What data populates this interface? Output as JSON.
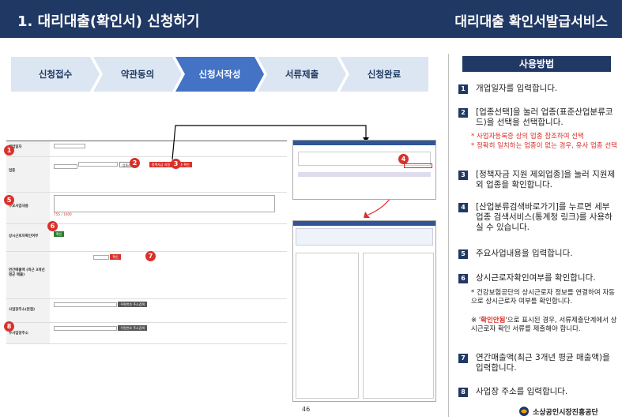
{
  "header": {
    "title": "1. 대리대출(확인서) 신청하기",
    "service": "대리대출 확인서발급서비스"
  },
  "steps": [
    {
      "label": "신청접수",
      "active": false
    },
    {
      "label": "약관동의",
      "active": false
    },
    {
      "label": "신청서작성",
      "active": true
    },
    {
      "label": "서류제출",
      "active": false
    },
    {
      "label": "신청완료",
      "active": false
    }
  ],
  "usage": {
    "title": "사용방법",
    "items": [
      {
        "num": "1",
        "text": "개업일자를 입력합니다."
      },
      {
        "num": "2",
        "text": "[업종선택]을 눌러 업종(표준산업분류코드)을 선택을 선택합니다."
      },
      {
        "num": "3",
        "text": "[정책자금 지원 제외업종]을 눌러 지원제외 업종을 확인합니다."
      },
      {
        "num": "4",
        "text": "[산업분류검색바로가기]를 누르면 세부업종 검색서비스(통계청 링크)를 사용하실 수 있습니다."
      },
      {
        "num": "5",
        "text": "주요사업내용을 입력합니다."
      },
      {
        "num": "6",
        "text": "상시근로자확인여부를 확인합니다."
      },
      {
        "num": "7",
        "text": "연간매출액(최근 3개년 평균 매출액)을 입력합니다."
      },
      {
        "num": "8",
        "text": "사업장 주소를 입력합니다."
      }
    ],
    "note2_a": "* 사업자등록증 상의 업종 참조하여 선택",
    "note2_b": "* 정확히 일치하는 업종이 없는 경우, 유사 업종 선택",
    "note6_a": "* 건강보험공단의 상시근로자 정보를 연결하여 자동으로 상시근로자 여부를 확인합니다.",
    "note6_b_pre": "※ '",
    "note6_b_red": "확인안됨",
    "note6_b_post": "'으로 표시된 경우, 서류제출단계에서 상시근로자 확인 서류를 제출해야 합니다."
  },
  "form": {
    "open_date": "개업일자",
    "industry": "업종",
    "industry_btn": "업종선택",
    "exclude_btn": "정책자금 지원 제외업종 확인",
    "main_business": "주요사업내용",
    "workers": "상시근로자확인여부",
    "workers_btn": "확인",
    "sales": "연간매출액 (최근 3개년 평균 매출)",
    "sales_btn": "확인",
    "addr1": "사업장주소(본점)",
    "addr2": "주사업장주소",
    "addr_btn": "우편번호 주소검색",
    "counter": "755 / 1000"
  },
  "page_number": "46",
  "logo": "소상공인시장진흥공단",
  "colors": {
    "navy": "#203864",
    "red": "#d9312b",
    "step_inactive": "#dce6f2",
    "step_active": "#4472c4"
  }
}
